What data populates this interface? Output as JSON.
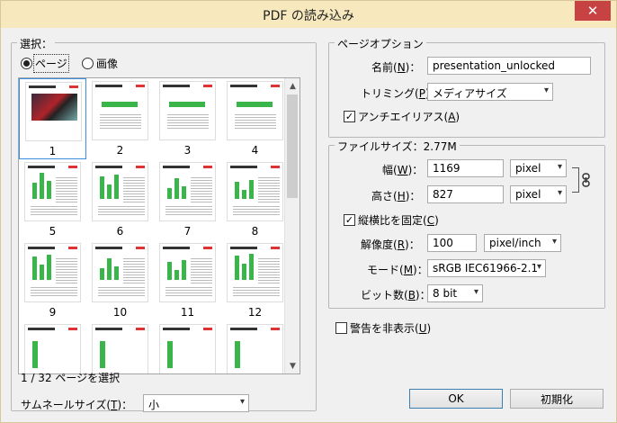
{
  "window": {
    "title": "PDF の読み込み",
    "close_glyph": "✕"
  },
  "select_group": {
    "legend": "選択：",
    "radio_pages": "ページ",
    "radio_images": "画像",
    "thumbnails": [
      {
        "num": "1"
      },
      {
        "num": "2"
      },
      {
        "num": "3"
      },
      {
        "num": "4"
      },
      {
        "num": "5"
      },
      {
        "num": "6"
      },
      {
        "num": "7"
      },
      {
        "num": "8"
      },
      {
        "num": "9"
      },
      {
        "num": "10"
      },
      {
        "num": "11"
      },
      {
        "num": "12"
      }
    ],
    "status": "1 / 32 ページを選択",
    "thumb_size_label_pre": "サムネールサイズ(",
    "thumb_size_key": "T",
    "thumb_size_label_post": ")：",
    "thumb_size_value": "小"
  },
  "page_options": {
    "legend": "ページオプション",
    "name_label_pre": "名前(",
    "name_key": "N",
    "name_label_post": ")：",
    "name_value": "presentation_unlocked",
    "crop_label_pre": "トリミング(",
    "crop_key": "P",
    "crop_label_post": ")：",
    "crop_value": "メディアサイズ",
    "antialias_pre": "アンチエイリアス(",
    "antialias_key": "A",
    "antialias_post": ")"
  },
  "image_size": {
    "legend": "ファイルサイズ：2.77M",
    "width_label_pre": "幅(",
    "width_key": "W",
    "width_label_post": ")：",
    "width_value": "1169",
    "width_unit": "pixel",
    "height_label_pre": "高さ(",
    "height_key": "H",
    "height_label_post": ")：",
    "height_value": "827",
    "height_unit": "pixel",
    "constrain_pre": "縦横比を固定(",
    "constrain_key": "C",
    "constrain_post": ")",
    "res_label_pre": "解像度(",
    "res_key": "R",
    "res_label_post": ")：",
    "res_value": "100",
    "res_unit": "pixel/inch",
    "mode_label_pre": "モード(",
    "mode_key": "M",
    "mode_label_post": ")：",
    "mode_value": "sRGB IEC61966-2.1",
    "bit_label_pre": "ビット数(",
    "bit_key": "B",
    "bit_label_post": ")：",
    "bit_value": "8 bit"
  },
  "suppress_warnings_pre": "警告を非表示(",
  "suppress_warnings_key": "U",
  "suppress_warnings_post": ")",
  "buttons": {
    "ok": "OK",
    "reset": "初期化"
  },
  "icons": {
    "chevron": "▾",
    "check": "✓",
    "scroll_up": "▲",
    "scroll_down": "▼",
    "link": "link-icon"
  }
}
